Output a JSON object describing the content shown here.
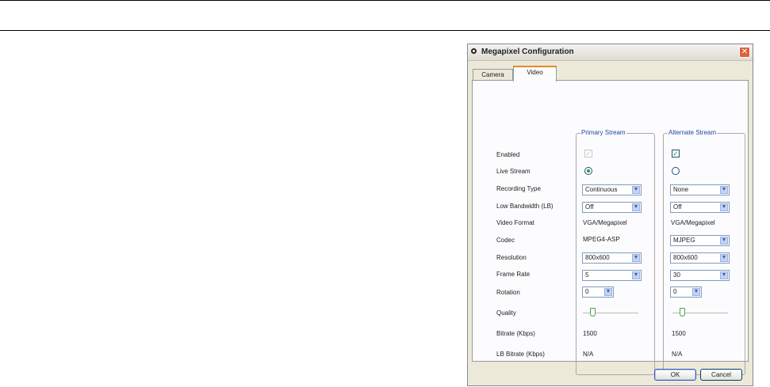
{
  "window": {
    "title": "Megapixel Configuration",
    "close_symbol": "✕"
  },
  "tabs": [
    {
      "label": "Camera",
      "active": false
    },
    {
      "label": "Video",
      "active": true
    }
  ],
  "groups": {
    "primary": "Primary Stream",
    "alternate": "Alternate Stream"
  },
  "labels": {
    "enabled": "Enabled",
    "live_stream": "Live Stream",
    "recording_type": "Recording Type",
    "low_bandwidth": "Low Bandwidth (LB)",
    "video_format": "Video Format",
    "codec": "Codec",
    "resolution": "Resolution",
    "frame_rate": "Frame Rate",
    "rotation": "Rotation",
    "quality": "Quality",
    "bitrate": "Bitrate (Kbps)",
    "lb_bitrate": "LB Bitrate (Kbps)"
  },
  "primary": {
    "enabled": true,
    "enabled_disabled": true,
    "live_stream": true,
    "recording_type": "Continuous",
    "low_bandwidth": "Off",
    "video_format": "VGA/Megapixel",
    "codec": "MPEG4-ASP",
    "resolution": "800x600",
    "frame_rate": "5",
    "rotation": "0",
    "quality": 0.15,
    "bitrate": "1500",
    "lb_bitrate": "N/A"
  },
  "alternate": {
    "enabled": true,
    "live_stream": false,
    "recording_type": "None",
    "low_bandwidth": "Off",
    "video_format": "VGA/Megapixel",
    "codec": "MJPEG",
    "resolution": "800x600",
    "frame_rate": "30",
    "rotation": "0",
    "quality": 0.15,
    "bitrate": "1500",
    "lb_bitrate": "N/A"
  },
  "checkmark": "✓",
  "dropdown_arrow": "▼",
  "buttons": {
    "ok": "OK",
    "cancel": "Cancel"
  },
  "icons": {
    "title": "window-icon",
    "close": "close-icon",
    "dropdown": "chevron-down-icon"
  }
}
